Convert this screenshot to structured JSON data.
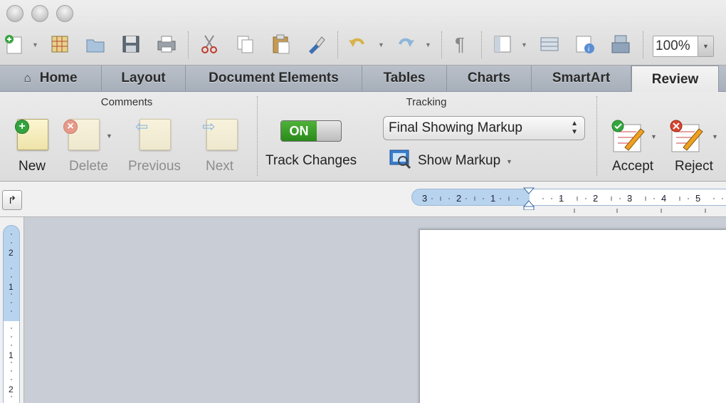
{
  "zoom": "100%",
  "tabs": [
    {
      "label": "Home"
    },
    {
      "label": "Layout"
    },
    {
      "label": "Document Elements"
    },
    {
      "label": "Tables"
    },
    {
      "label": "Charts"
    },
    {
      "label": "SmartArt"
    },
    {
      "label": "Review"
    }
  ],
  "active_tab": "Review",
  "ribbon": {
    "comments": {
      "title": "Comments",
      "new_label": "New",
      "delete_label": "Delete",
      "previous_label": "Previous",
      "next_label": "Next"
    },
    "tracking": {
      "title": "Tracking",
      "toggle_state": "ON",
      "track_changes_label": "Track Changes",
      "markup_select": "Final Showing Markup",
      "show_markup_label": "Show Markup"
    },
    "changes": {
      "accept_label": "Accept",
      "reject_label": "Reject"
    }
  },
  "hruler_numbers": [
    "3",
    "2",
    "1",
    "1",
    "2",
    "3",
    "4",
    "5"
  ],
  "vruler_numbers": [
    "2",
    "1",
    "1",
    "2"
  ],
  "colors": {
    "toggle_on": "#3c9e2a",
    "ruler_margin": "#b7d3ee"
  }
}
